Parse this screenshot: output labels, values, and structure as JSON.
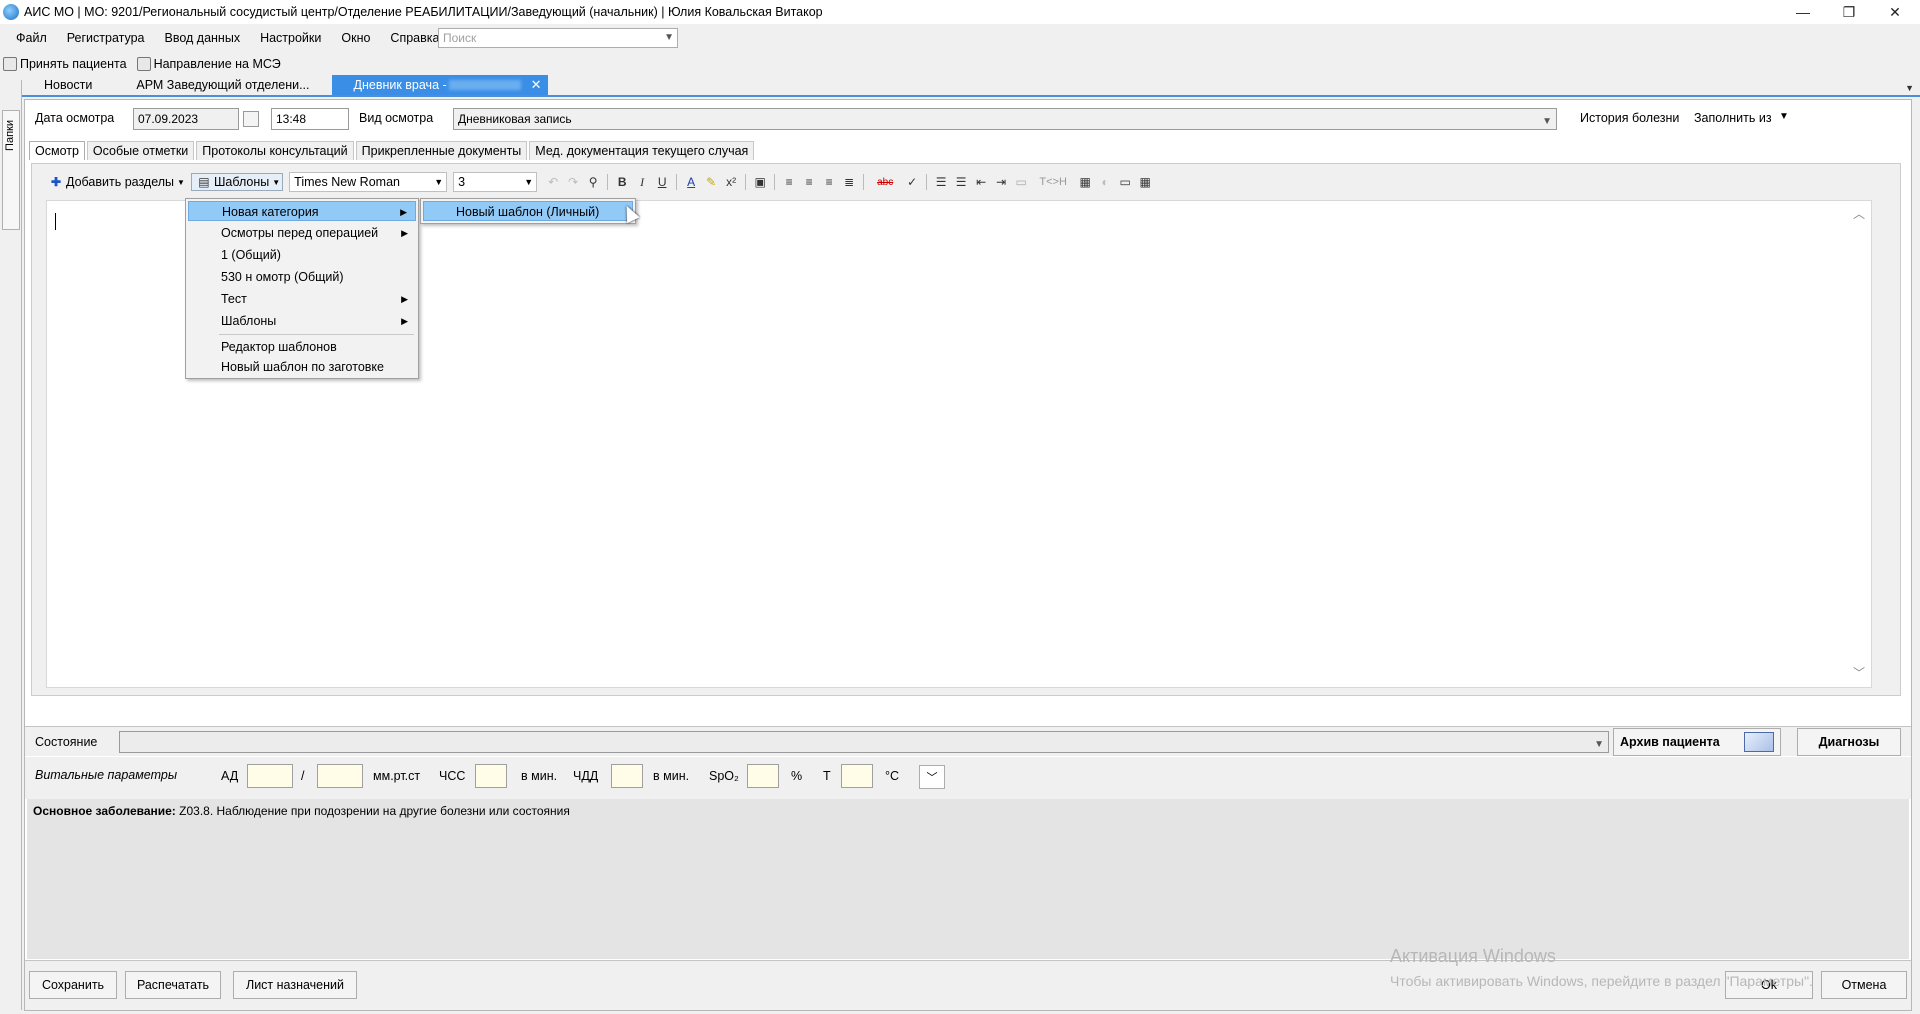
{
  "window": {
    "title": "АИС МО | МО: 9201/Региональный сосудистый центр/Отделение РЕАБИЛИТАЦИИ/Заведующий (начальник) | Юлия Ковальская Витакор",
    "minimize": "—",
    "restore": "❐",
    "close": "✕"
  },
  "menu": [
    "Файл",
    "Регистратура",
    "Ввод данных",
    "Настройки",
    "Окно",
    "Справка"
  ],
  "search": {
    "placeholder": "Поиск"
  },
  "quickbar": {
    "accept_patient": "Принять пациента",
    "mse_referral": "Направление на МСЭ"
  },
  "left_panel": {
    "label": "Папки"
  },
  "doc_tabs": {
    "news": "Новости",
    "arm": "АРМ Заведующий отделени...",
    "diary": "Дневник врача -"
  },
  "form": {
    "date_label": "Дата осмотра",
    "date_value": "07.09.2023",
    "time_value": "13:48",
    "exam_type_label": "Вид осмотра",
    "exam_type_value": "Дневниковая  запись",
    "history_link": "История болезни",
    "fill_from": "Заполнить из"
  },
  "inner_tabs": [
    "Осмотр",
    "Особые отметки",
    "Протоколы консультаций",
    "Прикрепленные документы",
    "Мед. документация текущего случая"
  ],
  "toolbar": {
    "add_sections": "Добавить разделы",
    "templates": "Шаблоны",
    "font": "Times New Roman",
    "size": "3",
    "tag_label": "T<>H"
  },
  "templates_menu": {
    "items": [
      {
        "label": "Новая категория",
        "submenu": true
      },
      {
        "label": "Осмотры перед операцией",
        "submenu": true
      },
      {
        "label": "1 (Общий)",
        "submenu": false
      },
      {
        "label": "530 н омотр (Общий)",
        "submenu": false
      },
      {
        "label": "Тест",
        "submenu": true
      },
      {
        "label": "Шаблоны",
        "submenu": true
      },
      {
        "label": "Редактор шаблонов",
        "submenu": false
      },
      {
        "label": "Новый шаблон по заготовке",
        "submenu": false
      }
    ],
    "submenu_item": "Новый шаблон (Личный)"
  },
  "bottom": {
    "state_label": "Состояние",
    "archive_button": "Архив пациента",
    "diagnoses_button": "Диагнозы",
    "vitals_label": "Витальные параметры",
    "ad": "АД",
    "slash": "/",
    "mmhg": "мм.рт.ст",
    "chss": "ЧСС",
    "per_min": "в мин.",
    "chdd": "ЧДД",
    "per_min2": "в мин.",
    "spo2": "SpO₂",
    "percent": "%",
    "t": "Т",
    "celsius": "°C",
    "diagnosis_title": "Основное заболевание:",
    "diagnosis_text": "Z03.8. Наблюдение при подозрении на другие болезни или состояния"
  },
  "footer": {
    "save": "Сохранить",
    "print": "Распечатать",
    "prescriptions": "Лист назначений",
    "ok": "Ok",
    "cancel": "Отмена"
  },
  "watermark": {
    "line1": "Активация Windows",
    "line2": "Чтобы активировать Windows, перейдите в раздел \"Параметры\"."
  }
}
